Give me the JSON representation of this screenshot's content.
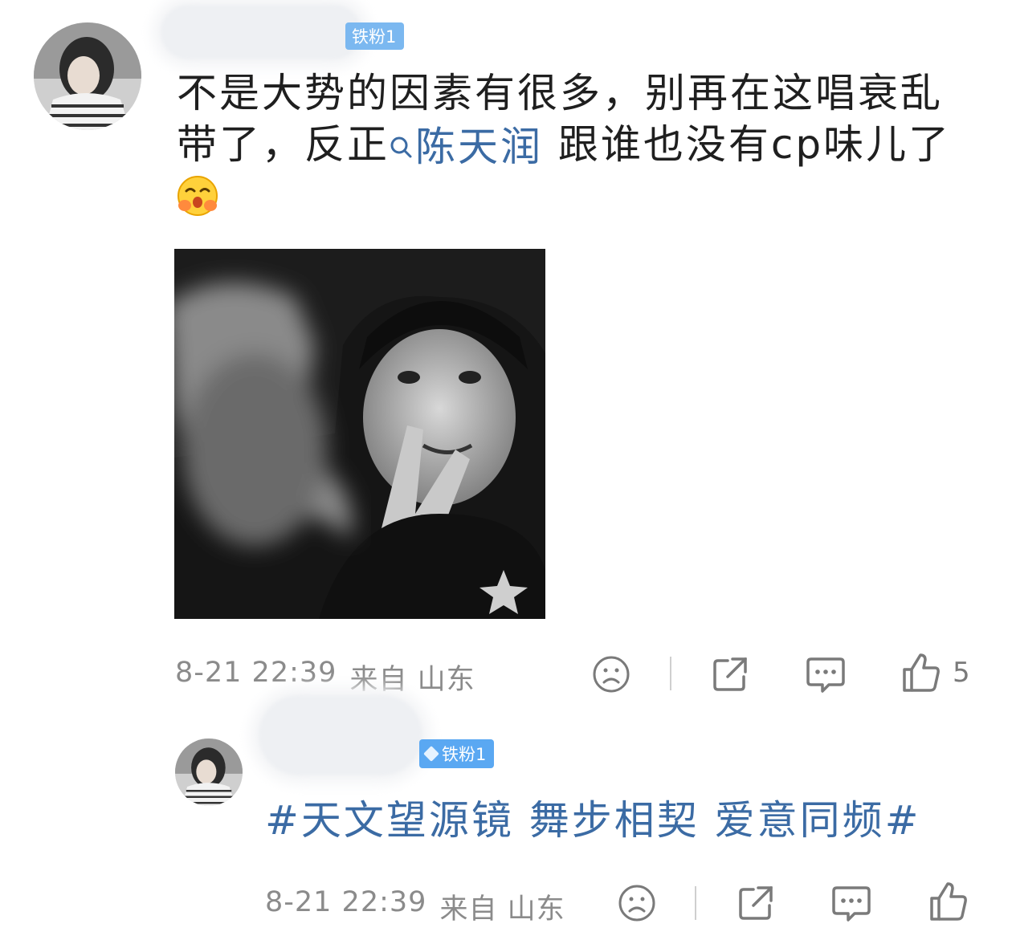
{
  "comment": {
    "fan_badge": "铁粉1",
    "text_before_mention": "不是大势的因素有很多，别再在这唱衰乱带了，反正",
    "mention": "陈天润",
    "text_after_mention": " 跟谁也没有cp味儿了",
    "emoji": "blush-emoji",
    "time": "8-21 22:39",
    "location": "来自 山东",
    "like_count": "5"
  },
  "reply": {
    "fan_badge": "铁粉1",
    "topic": "#天文望源镜 舞步相契 爱意同频#",
    "time": "8-21 22:39",
    "location": "来自 山东"
  },
  "icons": {
    "frown": "frown-icon",
    "share": "share-icon",
    "comment": "comment-icon",
    "like": "thumbs-up-icon",
    "search": "search-icon"
  },
  "colors": {
    "mention": "#3b6ba4",
    "badge": "#5aa8f2",
    "meta": "#8b8b8b"
  }
}
